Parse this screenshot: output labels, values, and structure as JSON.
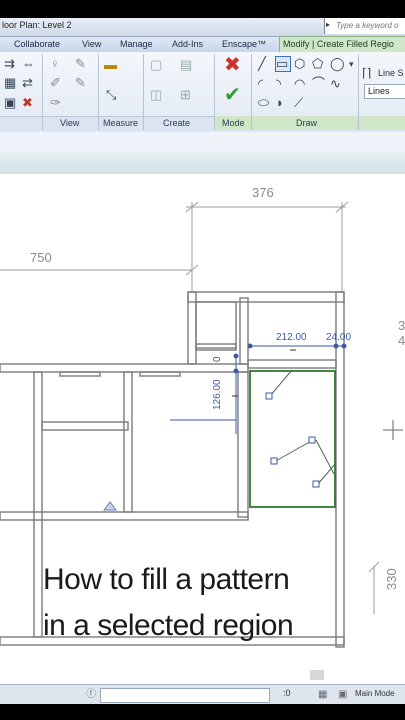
{
  "window": {
    "title": "loor Plan: Level 2",
    "search_placeholder": "Type a keyword o",
    "search_arrow": "▸"
  },
  "menu": {
    "tabs": [
      "Collaborate",
      "View",
      "Manage",
      "Add-Ins",
      "Enscape™"
    ],
    "active_tab": "Modify | Create Filled Regio"
  },
  "ribbon": {
    "panels": {
      "view": "View",
      "measure": "Measure",
      "create": "Create",
      "mode": "Mode",
      "draw": "Draw"
    },
    "line_style_label": "Line S",
    "line_style_value": "Lines"
  },
  "plan": {
    "dimensions": {
      "top_width": "376",
      "left_width": "750",
      "region_width": "212.00",
      "region_offset": "24.00",
      "vertical": "126.00",
      "vertical_small": "0",
      "right_vertical": "330",
      "edge_3": "3",
      "edge_4": "4"
    }
  },
  "caption": {
    "line1": "How to fill a pattern",
    "line2": "in a selected region"
  },
  "status": {
    "zero": ":0",
    "model": "Main Mode"
  },
  "colors": {
    "selection": "#3b5aa8",
    "region_outline": "#2f7a2f",
    "active_tab": "#cfe6c9"
  }
}
